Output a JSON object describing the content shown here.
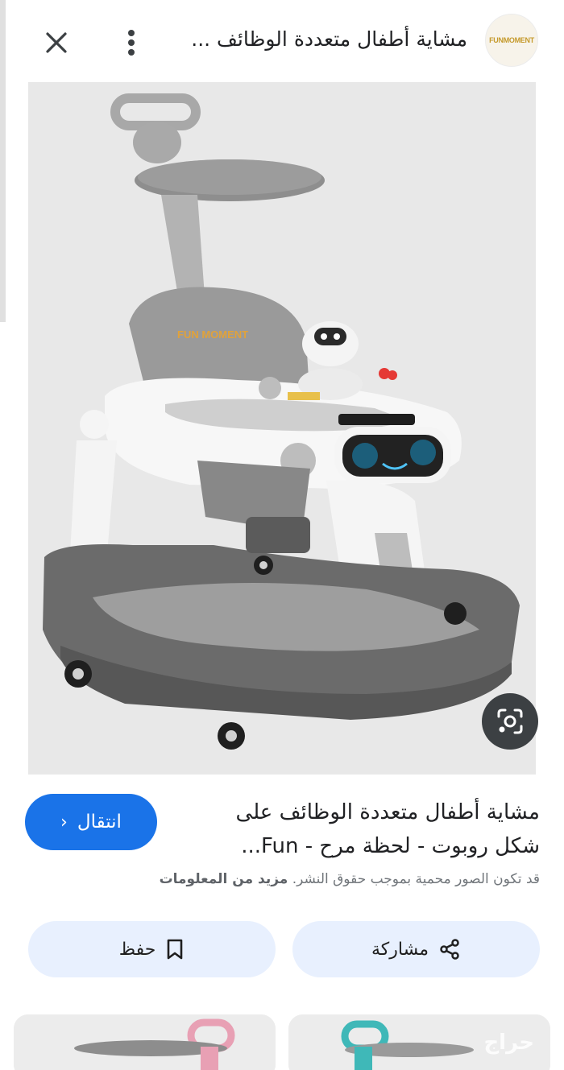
{
  "header": {
    "title": "مشاية أطفال متعددة الوظائف ...",
    "close_icon": "close-icon",
    "more_icon": "more-vert-icon",
    "site_logo_text": "FUNMOMENT"
  },
  "image": {
    "brand_text": "FUN MOMENT",
    "lens_icon": "google-lens-icon"
  },
  "result": {
    "title_line1": "مشاية أطفال متعددة الوظائف على",
    "title_line2": "شكل روبوت - لحظة مرح - Fun...",
    "goto_label": "انتقال",
    "copyright_text": "قد تكون الصور محمية بموجب حقوق النشر.",
    "more_info_label": "مزيد من المعلومات"
  },
  "actions": {
    "share_label": "مشاركة",
    "save_label": "حفظ"
  },
  "related": {
    "watermark_text": "حراج"
  },
  "colors": {
    "accent": "#1a73e8",
    "action_bg": "#e8f0fe",
    "lens_bg": "#3c4043"
  }
}
